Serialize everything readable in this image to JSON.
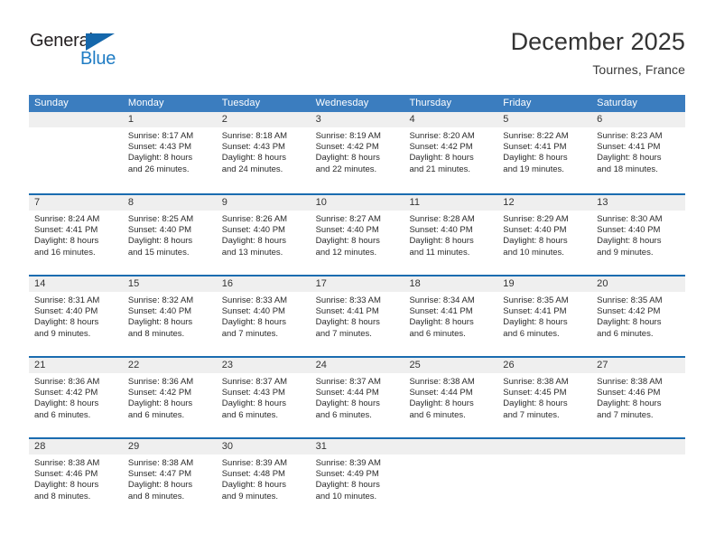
{
  "brand": {
    "name_part1": "General",
    "name_part2": "Blue",
    "triangle_icon": "triangle-icon",
    "triangle_color": "#1567ab",
    "blue_color": "#1f7cc4"
  },
  "header": {
    "month_title": "December 2025",
    "location": "Tournes, France"
  },
  "theme": {
    "header_bar_color": "#3b7dbf",
    "row_divider_color": "#1b6cb0",
    "day_number_bg": "#efefef",
    "text_color": "#2b2b2b"
  },
  "calendar": {
    "weekdays": [
      "Sunday",
      "Monday",
      "Tuesday",
      "Wednesday",
      "Thursday",
      "Friday",
      "Saturday"
    ],
    "weeks": [
      [
        {
          "day": "",
          "sunrise": "",
          "sunset": "",
          "daylight_line1": "",
          "daylight_line2": ""
        },
        {
          "day": "1",
          "sunrise": "Sunrise: 8:17 AM",
          "sunset": "Sunset: 4:43 PM",
          "daylight_line1": "Daylight: 8 hours",
          "daylight_line2": "and 26 minutes."
        },
        {
          "day": "2",
          "sunrise": "Sunrise: 8:18 AM",
          "sunset": "Sunset: 4:43 PM",
          "daylight_line1": "Daylight: 8 hours",
          "daylight_line2": "and 24 minutes."
        },
        {
          "day": "3",
          "sunrise": "Sunrise: 8:19 AM",
          "sunset": "Sunset: 4:42 PM",
          "daylight_line1": "Daylight: 8 hours",
          "daylight_line2": "and 22 minutes."
        },
        {
          "day": "4",
          "sunrise": "Sunrise: 8:20 AM",
          "sunset": "Sunset: 4:42 PM",
          "daylight_line1": "Daylight: 8 hours",
          "daylight_line2": "and 21 minutes."
        },
        {
          "day": "5",
          "sunrise": "Sunrise: 8:22 AM",
          "sunset": "Sunset: 4:41 PM",
          "daylight_line1": "Daylight: 8 hours",
          "daylight_line2": "and 19 minutes."
        },
        {
          "day": "6",
          "sunrise": "Sunrise: 8:23 AM",
          "sunset": "Sunset: 4:41 PM",
          "daylight_line1": "Daylight: 8 hours",
          "daylight_line2": "and 18 minutes."
        }
      ],
      [
        {
          "day": "7",
          "sunrise": "Sunrise: 8:24 AM",
          "sunset": "Sunset: 4:41 PM",
          "daylight_line1": "Daylight: 8 hours",
          "daylight_line2": "and 16 minutes."
        },
        {
          "day": "8",
          "sunrise": "Sunrise: 8:25 AM",
          "sunset": "Sunset: 4:40 PM",
          "daylight_line1": "Daylight: 8 hours",
          "daylight_line2": "and 15 minutes."
        },
        {
          "day": "9",
          "sunrise": "Sunrise: 8:26 AM",
          "sunset": "Sunset: 4:40 PM",
          "daylight_line1": "Daylight: 8 hours",
          "daylight_line2": "and 13 minutes."
        },
        {
          "day": "10",
          "sunrise": "Sunrise: 8:27 AM",
          "sunset": "Sunset: 4:40 PM",
          "daylight_line1": "Daylight: 8 hours",
          "daylight_line2": "and 12 minutes."
        },
        {
          "day": "11",
          "sunrise": "Sunrise: 8:28 AM",
          "sunset": "Sunset: 4:40 PM",
          "daylight_line1": "Daylight: 8 hours",
          "daylight_line2": "and 11 minutes."
        },
        {
          "day": "12",
          "sunrise": "Sunrise: 8:29 AM",
          "sunset": "Sunset: 4:40 PM",
          "daylight_line1": "Daylight: 8 hours",
          "daylight_line2": "and 10 minutes."
        },
        {
          "day": "13",
          "sunrise": "Sunrise: 8:30 AM",
          "sunset": "Sunset: 4:40 PM",
          "daylight_line1": "Daylight: 8 hours",
          "daylight_line2": "and 9 minutes."
        }
      ],
      [
        {
          "day": "14",
          "sunrise": "Sunrise: 8:31 AM",
          "sunset": "Sunset: 4:40 PM",
          "daylight_line1": "Daylight: 8 hours",
          "daylight_line2": "and 9 minutes."
        },
        {
          "day": "15",
          "sunrise": "Sunrise: 8:32 AM",
          "sunset": "Sunset: 4:40 PM",
          "daylight_line1": "Daylight: 8 hours",
          "daylight_line2": "and 8 minutes."
        },
        {
          "day": "16",
          "sunrise": "Sunrise: 8:33 AM",
          "sunset": "Sunset: 4:40 PM",
          "daylight_line1": "Daylight: 8 hours",
          "daylight_line2": "and 7 minutes."
        },
        {
          "day": "17",
          "sunrise": "Sunrise: 8:33 AM",
          "sunset": "Sunset: 4:41 PM",
          "daylight_line1": "Daylight: 8 hours",
          "daylight_line2": "and 7 minutes."
        },
        {
          "day": "18",
          "sunrise": "Sunrise: 8:34 AM",
          "sunset": "Sunset: 4:41 PM",
          "daylight_line1": "Daylight: 8 hours",
          "daylight_line2": "and 6 minutes."
        },
        {
          "day": "19",
          "sunrise": "Sunrise: 8:35 AM",
          "sunset": "Sunset: 4:41 PM",
          "daylight_line1": "Daylight: 8 hours",
          "daylight_line2": "and 6 minutes."
        },
        {
          "day": "20",
          "sunrise": "Sunrise: 8:35 AM",
          "sunset": "Sunset: 4:42 PM",
          "daylight_line1": "Daylight: 8 hours",
          "daylight_line2": "and 6 minutes."
        }
      ],
      [
        {
          "day": "21",
          "sunrise": "Sunrise: 8:36 AM",
          "sunset": "Sunset: 4:42 PM",
          "daylight_line1": "Daylight: 8 hours",
          "daylight_line2": "and 6 minutes."
        },
        {
          "day": "22",
          "sunrise": "Sunrise: 8:36 AM",
          "sunset": "Sunset: 4:42 PM",
          "daylight_line1": "Daylight: 8 hours",
          "daylight_line2": "and 6 minutes."
        },
        {
          "day": "23",
          "sunrise": "Sunrise: 8:37 AM",
          "sunset": "Sunset: 4:43 PM",
          "daylight_line1": "Daylight: 8 hours",
          "daylight_line2": "and 6 minutes."
        },
        {
          "day": "24",
          "sunrise": "Sunrise: 8:37 AM",
          "sunset": "Sunset: 4:44 PM",
          "daylight_line1": "Daylight: 8 hours",
          "daylight_line2": "and 6 minutes."
        },
        {
          "day": "25",
          "sunrise": "Sunrise: 8:38 AM",
          "sunset": "Sunset: 4:44 PM",
          "daylight_line1": "Daylight: 8 hours",
          "daylight_line2": "and 6 minutes."
        },
        {
          "day": "26",
          "sunrise": "Sunrise: 8:38 AM",
          "sunset": "Sunset: 4:45 PM",
          "daylight_line1": "Daylight: 8 hours",
          "daylight_line2": "and 7 minutes."
        },
        {
          "day": "27",
          "sunrise": "Sunrise: 8:38 AM",
          "sunset": "Sunset: 4:46 PM",
          "daylight_line1": "Daylight: 8 hours",
          "daylight_line2": "and 7 minutes."
        }
      ],
      [
        {
          "day": "28",
          "sunrise": "Sunrise: 8:38 AM",
          "sunset": "Sunset: 4:46 PM",
          "daylight_line1": "Daylight: 8 hours",
          "daylight_line2": "and 8 minutes."
        },
        {
          "day": "29",
          "sunrise": "Sunrise: 8:38 AM",
          "sunset": "Sunset: 4:47 PM",
          "daylight_line1": "Daylight: 8 hours",
          "daylight_line2": "and 8 minutes."
        },
        {
          "day": "30",
          "sunrise": "Sunrise: 8:39 AM",
          "sunset": "Sunset: 4:48 PM",
          "daylight_line1": "Daylight: 8 hours",
          "daylight_line2": "and 9 minutes."
        },
        {
          "day": "31",
          "sunrise": "Sunrise: 8:39 AM",
          "sunset": "Sunset: 4:49 PM",
          "daylight_line1": "Daylight: 8 hours",
          "daylight_line2": "and 10 minutes."
        },
        {
          "day": "",
          "sunrise": "",
          "sunset": "",
          "daylight_line1": "",
          "daylight_line2": ""
        },
        {
          "day": "",
          "sunrise": "",
          "sunset": "",
          "daylight_line1": "",
          "daylight_line2": ""
        },
        {
          "day": "",
          "sunrise": "",
          "sunset": "",
          "daylight_line1": "",
          "daylight_line2": ""
        }
      ]
    ]
  }
}
